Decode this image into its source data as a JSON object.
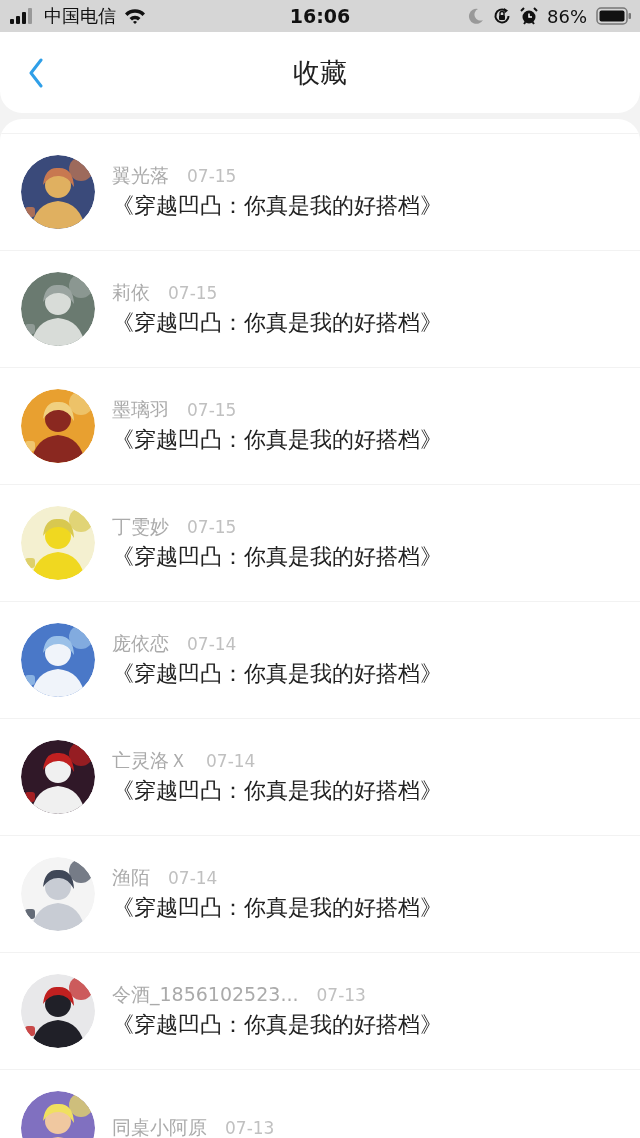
{
  "status_bar": {
    "carrier": "中国电信",
    "time": "16:06",
    "battery": "86%"
  },
  "header": {
    "title": "收藏"
  },
  "favorites": [
    {
      "user": "翼光落",
      "date": "07-15",
      "title": "《穿越凹凸：你真是我的好搭档》"
    },
    {
      "user": "莉依",
      "date": "07-15",
      "title": "《穿越凹凸：你真是我的好搭档》"
    },
    {
      "user": "墨璃羽",
      "date": "07-15",
      "title": "《穿越凹凸：你真是我的好搭档》"
    },
    {
      "user": "丁雯妙",
      "date": "07-15",
      "title": "《穿越凹凸：你真是我的好搭档》"
    },
    {
      "user": "庞依恋",
      "date": "07-14",
      "title": "《穿越凹凸：你真是我的好搭档》"
    },
    {
      "user": "亡灵洛Ｘ",
      "date": "07-14",
      "title": "《穿越凹凸：你真是我的好搭档》"
    },
    {
      "user": "渔陌",
      "date": "07-14",
      "title": "《穿越凹凸：你真是我的好搭档》"
    },
    {
      "user": "令酒_1856102523...",
      "date": "07-13",
      "title": "《穿越凹凸：你真是我的好搭档》"
    },
    {
      "user": "同桌小阿原",
      "date": "07-13"
    }
  ]
}
